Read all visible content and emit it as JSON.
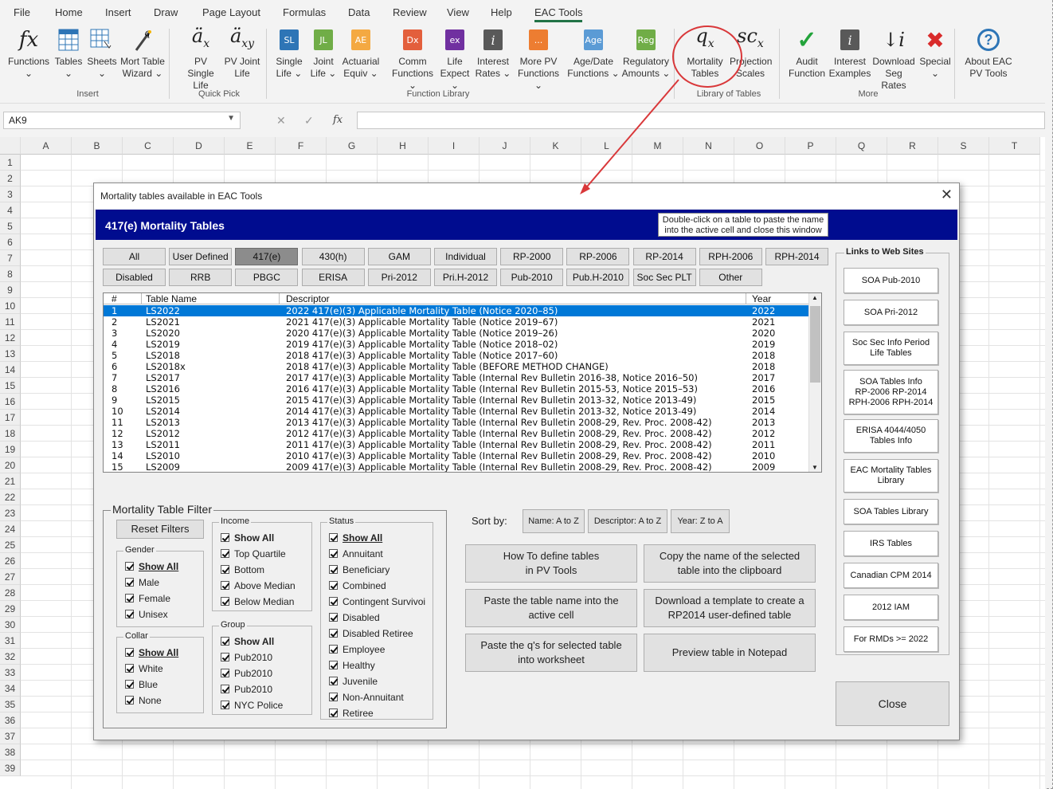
{
  "tabs": [
    "File",
    "Home",
    "Insert",
    "Draw",
    "Page Layout",
    "Formulas",
    "Data",
    "Review",
    "View",
    "Help",
    "EAC Tools"
  ],
  "ribbon": {
    "buttons": [
      {
        "label": "Functions",
        "sub": "⌄",
        "icon": "fx"
      },
      {
        "label": "Tables",
        "sub": "⌄",
        "icon": "table"
      },
      {
        "label": "Sheets",
        "sub": "⌄",
        "icon": "sheets"
      },
      {
        "label": "Mort Table",
        "sub": "Wizard ⌄",
        "icon": "wizard"
      },
      {
        "label": "PV Single",
        "sub": "Life",
        "icon": "äx"
      },
      {
        "label": "PV Joint",
        "sub": "Life",
        "icon": "äxy"
      },
      {
        "label": "Single",
        "sub": "Life ⌄",
        "icon": "SL"
      },
      {
        "label": "Joint",
        "sub": "Life ⌄",
        "icon": "JL"
      },
      {
        "label": "Actuarial",
        "sub": "Equiv ⌄",
        "icon": "AE"
      },
      {
        "label": "Comm",
        "sub": "Functions ⌄",
        "icon": "Dx"
      },
      {
        "label": "Life",
        "sub": "Expect ⌄",
        "icon": "ex"
      },
      {
        "label": "Interest",
        "sub": "Rates ⌄",
        "icon": "i"
      },
      {
        "label": "More PV",
        "sub": "Functions ⌄",
        "icon": "..."
      },
      {
        "label": "Age/Date",
        "sub": "Functions ⌄",
        "icon": "Age"
      },
      {
        "label": "Regulatory",
        "sub": "Amounts ⌄",
        "icon": "Reg"
      },
      {
        "label": "Mortality",
        "sub": "Tables",
        "icon": "qx"
      },
      {
        "label": "Projection",
        "sub": "Scales",
        "icon": "scx"
      },
      {
        "label": "Audit",
        "sub": "Function",
        "icon": "check"
      },
      {
        "label": "Interest",
        "sub": "Examples",
        "icon": "i"
      },
      {
        "label": "Download",
        "sub": "Seg Rates",
        "icon": "↓i"
      },
      {
        "label": "Special",
        "sub": "⌄",
        "icon": "tools"
      },
      {
        "label": "About EAC",
        "sub": "PV Tools",
        "icon": "?"
      }
    ],
    "groups": [
      "Insert",
      "Quick Pick",
      "Function Library",
      "Library of Tables",
      "More"
    ]
  },
  "formula": {
    "namebox": "AK9",
    "fx": "fx",
    "cancel": "✕",
    "enter": "✓"
  },
  "grid": {
    "columns": [
      "A",
      "B",
      "C",
      "D",
      "E",
      "F",
      "G",
      "H",
      "I",
      "J",
      "K",
      "L",
      "M",
      "N",
      "O",
      "P",
      "Q",
      "R",
      "S",
      "T"
    ],
    "rows": [
      "1",
      "2",
      "3",
      "4",
      "5",
      "6",
      "7",
      "8",
      "9",
      "10",
      "11",
      "12",
      "13",
      "14",
      "15",
      "16",
      "17",
      "18",
      "19",
      "20",
      "21",
      "22",
      "23",
      "24",
      "25",
      "26",
      "27",
      "28",
      "29",
      "30",
      "31",
      "32",
      "33",
      "34",
      "35",
      "36",
      "37",
      "38",
      "39"
    ]
  },
  "dialog": {
    "title": "Mortality tables available in EAC Tools",
    "close": "✕",
    "banner": "417(e) Mortality Tables",
    "hint": "Double-click on a table to paste the name into the active cell and close this window",
    "filters_row1": [
      "All",
      "User Defined",
      "417(e)",
      "430(h)",
      "GAM",
      "Individual",
      "RP-2000",
      "RP-2006",
      "RP-2014",
      "RPH-2006",
      "RPH-2014"
    ],
    "filters_row2": [
      "Disabled",
      "RRB",
      "PBGC",
      "ERISA",
      "Pri-2012",
      "Pri.H-2012",
      "Pub-2010",
      "Pub.H-2010",
      "Soc Sec PLT",
      "Other"
    ],
    "selected_filter": "417(e)",
    "list_headers": [
      "#",
      "Table Name",
      "Descriptor",
      "Year"
    ],
    "rows": [
      [
        "1",
        "LS2022",
        "2022 417(e)(3) Applicable Mortality Table (Notice 2020–85)",
        "2022"
      ],
      [
        "2",
        "LS2021",
        "2021 417(e)(3) Applicable Mortality Table (Notice 2019–67)",
        "2021"
      ],
      [
        "3",
        "LS2020",
        "2020 417(e)(3) Applicable Mortality Table (Notice 2019–26)",
        "2020"
      ],
      [
        "4",
        "LS2019",
        "2019 417(e)(3) Applicable Mortality Table (Notice 2018–02)",
        "2019"
      ],
      [
        "5",
        "LS2018",
        "2018 417(e)(3) Applicable Mortality Table (Notice 2017–60)",
        "2018"
      ],
      [
        "6",
        "LS2018x",
        "2018 417(e)(3) Applicable Mortality Table (BEFORE METHOD CHANGE)",
        "2018"
      ],
      [
        "7",
        "LS2017",
        "2017 417(e)(3) Applicable Mortality Table (Internal Rev Bulletin 2016-38, Notice 2016–50)",
        "2017"
      ],
      [
        "8",
        "LS2016",
        "2016 417(e)(3) Applicable Mortality Table (Internal Rev Bulletin 2015-53, Notice 2015–53)",
        "2016"
      ],
      [
        "9",
        "LS2015",
        "2015 417(e)(3) Applicable Mortality Table (Internal Rev Bulletin 2013-32, Notice 2013-49)",
        "2015"
      ],
      [
        "10",
        "LS2014",
        "2014 417(e)(3) Applicable Mortality Table (Internal Rev Bulletin 2013-32, Notice 2013-49)",
        "2014"
      ],
      [
        "11",
        "LS2013",
        "2013 417(e)(3) Applicable Mortality Table (Internal Rev Bulletin 2008-29, Rev. Proc. 2008-42)",
        "2013"
      ],
      [
        "12",
        "LS2012",
        "2012 417(e)(3) Applicable Mortality Table (Internal Rev Bulletin 2008-29, Rev. Proc. 2008-42)",
        "2012"
      ],
      [
        "13",
        "LS2011",
        "2011 417(e)(3) Applicable Mortality Table (Internal Rev Bulletin 2008-29, Rev. Proc. 2008-42)",
        "2011"
      ],
      [
        "14",
        "LS2010",
        "2010 417(e)(3) Applicable Mortality Table (Internal Rev Bulletin 2008-29, Rev. Proc. 2008-42)",
        "2010"
      ],
      [
        "15",
        "LS2009",
        "2009 417(e)(3) Applicable Mortality Table (Internal Rev Bulletin 2008-29, Rev. Proc. 2008-42)",
        "2009"
      ]
    ],
    "filter_title": "Mortality Table Filter",
    "reset": "Reset Filters",
    "gender": {
      "label": "Gender",
      "items": [
        "Show All",
        "Male",
        "Female",
        "Unisex"
      ]
    },
    "collar": {
      "label": "Collar",
      "items": [
        "Show All",
        "White",
        "Blue",
        "None"
      ]
    },
    "income": {
      "label": "Income",
      "items": [
        "Show All",
        "Top Quartile",
        "Bottom",
        "Above Median",
        "Below Median"
      ]
    },
    "group": {
      "label": "Group",
      "items": [
        "Show All",
        "Pub2010",
        "Pub2010",
        "Pub2010",
        "NYC Police"
      ]
    },
    "status": {
      "label": "Status",
      "items": [
        "Show All",
        "Annuitant",
        "Beneficiary",
        "Combined",
        "Contingent Survivoi",
        "Disabled",
        "Disabled Retiree",
        "Employee",
        "Healthy",
        "Juvenile",
        "Non-Annuitant",
        "Retiree"
      ]
    },
    "sort_label": "Sort by:",
    "sort_buttons": [
      "Name: A to Z",
      "Descriptor: A to Z",
      "Year: Z to A"
    ],
    "actions": [
      "How To define tables\nin PV Tools",
      "Copy the name of the selected\ntable into the clipboard",
      "Paste the table name into the\nactive cell",
      "Download a template to create a\nRP2014 user-defined table",
      "Paste the q's for selected table\ninto worksheet",
      "Preview table in Notepad"
    ],
    "links_title": "Links to Web Sites",
    "links": [
      "SOA Pub-2010",
      "SOA Pri-2012",
      "Soc Sec Info Period\nLife Tables",
      "SOA Tables Info\nRP-2006   RP-2014\nRPH-2006  RPH-2014",
      "ERISA 4044/4050\nTables Info",
      "EAC Mortality Tables\nLibrary",
      "SOA Tables Library",
      "IRS Tables",
      "Canadian CPM 2014",
      "2012 IAM",
      "For RMDs >= 2022"
    ],
    "close_button": "Close"
  },
  "colors": {
    "banner": "#000c8f",
    "selection": "#0078d7",
    "annotation": "#d9383a"
  }
}
